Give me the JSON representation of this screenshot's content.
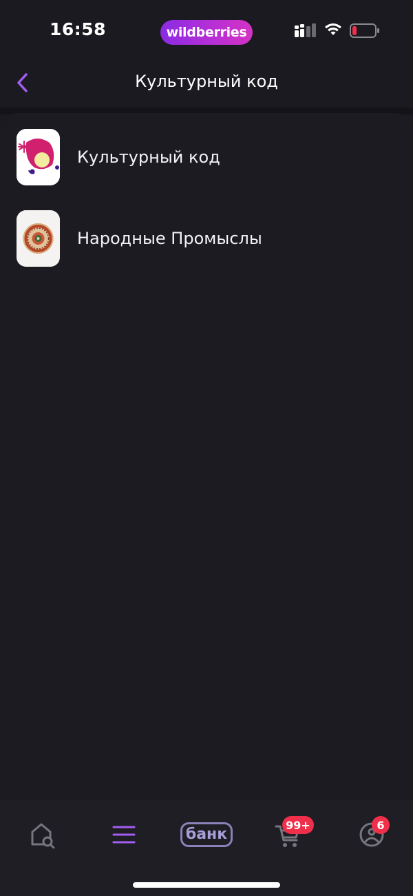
{
  "status_bar": {
    "time": "16:58",
    "brand": "wildberries",
    "icons": {
      "signal": "cellular-signal-icon",
      "wifi": "wifi-icon",
      "battery": "battery-low-icon"
    },
    "colors": {
      "brand_gradient_start": "#8a2be2",
      "brand_gradient_end": "#d433c4",
      "battery_low": "#f0304a"
    }
  },
  "header": {
    "title": "Культурный код",
    "back_icon": "chevron-left-icon",
    "accent": "#a15ef0"
  },
  "list": {
    "items": [
      {
        "label": "Культурный код",
        "icon": "culture-code-logo-icon"
      },
      {
        "label": "Народные Промыслы",
        "icon": "folk-crafts-plate-icon"
      }
    ]
  },
  "bottom_nav": {
    "items": [
      {
        "name": "home-search",
        "icon": "home-search-icon"
      },
      {
        "name": "catalog",
        "icon": "menu-lines-icon",
        "active": true
      },
      {
        "name": "bank",
        "label": "банк"
      },
      {
        "name": "cart",
        "icon": "cart-icon",
        "badge": "99+"
      },
      {
        "name": "profile",
        "icon": "profile-face-icon",
        "badge": "6"
      }
    ],
    "colors": {
      "active": "#a15ef0",
      "inactive": "#77767e",
      "badge": "#f0304a"
    }
  }
}
